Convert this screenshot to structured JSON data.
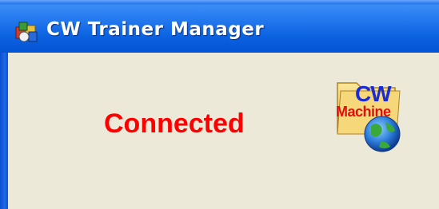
{
  "window": {
    "title": "CW Trainer Manager",
    "icon": "app-icon"
  },
  "main": {
    "status": "Connected",
    "status_color": "#ff0000"
  },
  "logo": {
    "line1": "CW",
    "line2": "Machine",
    "icon": "folder-globe-icon"
  },
  "colors": {
    "titlebar": "#0b62e0",
    "client_bg": "#ece9d8"
  }
}
